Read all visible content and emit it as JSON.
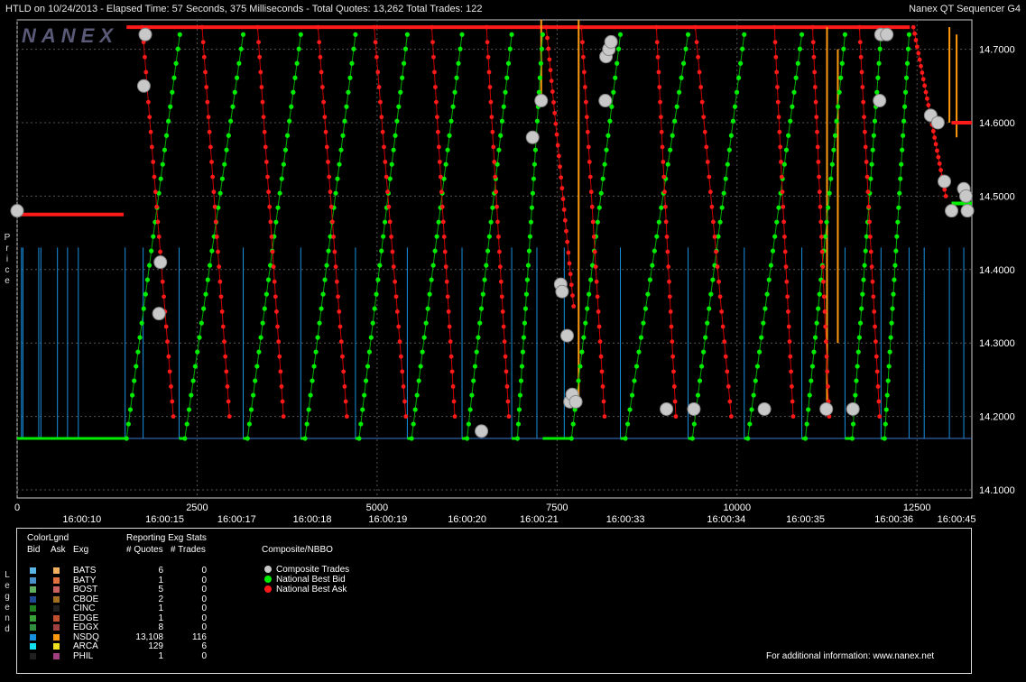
{
  "header": {
    "left": "HTLD on 10/24/2013  -  Elapsed Time: 57 Seconds, 375 Milliseconds  -  Total Quotes: 13,262  Total Trades: 122",
    "right": "Nanex QT Sequencer G4"
  },
  "watermark": "NANEX",
  "side_label_price": "Price",
  "side_label_legend": "Legend",
  "chart_data": {
    "type": "line",
    "y_ticks": [
      "14.7000",
      "14.6000",
      "14.5000",
      "14.4000",
      "14.3000",
      "14.2000",
      "14.1000"
    ],
    "y_tick_values": [
      14.7,
      14.6,
      14.5,
      14.4,
      14.3,
      14.2,
      14.1
    ],
    "ylim": [
      14.089,
      14.74
    ],
    "x_seq_ticks": [
      "0",
      "2500",
      "5000",
      "7500",
      "10000",
      "12500"
    ],
    "x_seq_values": [
      0,
      2500,
      5000,
      7500,
      10000,
      12500
    ],
    "xlim": [
      0,
      13262
    ],
    "x_time_ticks": [
      "16:00:10",
      "16:00:15",
      "16:00:17",
      "16:00:18",
      "16:00:19",
      "16:00:20",
      "16:00:21",
      "16:00:33",
      "16:00:34",
      "16:00:35",
      "16:00:36",
      "16:00:45"
    ],
    "x_time_positions": [
      900,
      2050,
      3050,
      4100,
      5150,
      6250,
      7250,
      8450,
      9850,
      10950,
      12180,
      13050
    ],
    "bid_floor": 14.17,
    "ask_ceiling": 14.73,
    "series": [
      {
        "name": "Composite Trades",
        "color": "#c8c8c8"
      },
      {
        "name": "National Best Bid",
        "color": "#00ee00"
      },
      {
        "name": "National Best Ask",
        "color": "#ff1a1a"
      }
    ],
    "bid_ramps": [
      [
        1520,
        2260,
        14.72
      ],
      [
        2330,
        3140,
        14.72
      ],
      [
        3200,
        3940,
        14.72
      ],
      [
        4000,
        4700,
        14.72
      ],
      [
        4750,
        5420,
        14.72
      ],
      [
        5480,
        6180,
        14.72
      ],
      [
        6250,
        6870,
        14.72
      ],
      [
        6950,
        7300,
        14.72
      ],
      [
        7700,
        8380,
        14.72
      ],
      [
        8450,
        9320,
        14.72
      ],
      [
        9380,
        10100,
        14.72
      ],
      [
        10150,
        10900,
        14.72
      ],
      [
        10950,
        11500,
        14.72
      ],
      [
        11600,
        12000,
        14.72
      ],
      [
        12050,
        12390,
        14.72
      ]
    ],
    "ask_drops": [
      [
        1740,
        14.73,
        2170,
        14.2
      ],
      [
        2570,
        14.73,
        2950,
        14.2
      ],
      [
        3340,
        14.73,
        3700,
        14.2
      ],
      [
        4180,
        14.73,
        4580,
        14.2
      ],
      [
        4960,
        14.73,
        5400,
        14.2
      ],
      [
        5760,
        14.73,
        6080,
        14.2
      ],
      [
        6520,
        14.73,
        6830,
        14.2
      ],
      [
        7350,
        14.73,
        7730,
        14.35
      ],
      [
        7840,
        14.73,
        8160,
        14.2
      ],
      [
        8880,
        14.73,
        9150,
        14.2
      ],
      [
        9420,
        14.73,
        9920,
        14.2
      ],
      [
        10520,
        14.73,
        10780,
        14.2
      ],
      [
        11050,
        14.73,
        11280,
        14.2
      ],
      [
        11700,
        14.73,
        11980,
        14.2
      ],
      [
        12450,
        14.73,
        12900,
        14.5
      ]
    ],
    "trades": [
      [
        0,
        14.48
      ],
      [
        1780,
        14.72
      ],
      [
        1760,
        14.65
      ],
      [
        1990,
        14.41
      ],
      [
        1970,
        14.34
      ],
      [
        6450,
        14.18
      ],
      [
        7160,
        14.58
      ],
      [
        7280,
        14.63
      ],
      [
        7550,
        14.38
      ],
      [
        7570,
        14.37
      ],
      [
        7640,
        14.31
      ],
      [
        7680,
        14.22
      ],
      [
        7710,
        14.23
      ],
      [
        7760,
        14.22
      ],
      [
        8180,
        14.69
      ],
      [
        8220,
        14.7
      ],
      [
        8250,
        14.71
      ],
      [
        8170,
        14.63
      ],
      [
        9020,
        14.21
      ],
      [
        9400,
        14.21
      ],
      [
        10380,
        14.21
      ],
      [
        11240,
        14.21
      ],
      [
        11610,
        14.21
      ],
      [
        11980,
        14.63
      ],
      [
        12000,
        14.72
      ],
      [
        12080,
        14.72
      ],
      [
        12690,
        14.61
      ],
      [
        12790,
        14.6
      ],
      [
        12880,
        14.52
      ],
      [
        12980,
        14.48
      ],
      [
        13150,
        14.51
      ],
      [
        13180,
        14.5
      ],
      [
        13200,
        14.48
      ]
    ]
  },
  "legend": {
    "title_color": "ColorLgnd",
    "col_bid": "Bid",
    "col_ask": "Ask",
    "col_exg": "Exg",
    "title_stats": "Reporting Exg Stats",
    "col_quotes": "# Quotes",
    "col_trades": "# Trades",
    "title_composite": "Composite/NBBO",
    "rows": [
      {
        "exg": "BATS",
        "quotes": "6",
        "trades": "0",
        "bid": "#5ab4e6",
        "ask": "#f0b060"
      },
      {
        "exg": "BATY",
        "quotes": "1",
        "trades": "0",
        "bid": "#4a90c8",
        "ask": "#e07040"
      },
      {
        "exg": "BOST",
        "quotes": "5",
        "trades": "0",
        "bid": "#60b060",
        "ask": "#c86060"
      },
      {
        "exg": "CBOE",
        "quotes": "2",
        "trades": "0",
        "bid": "#204890",
        "ask": "#a07020"
      },
      {
        "exg": "CINC",
        "quotes": "1",
        "trades": "0",
        "bid": "#208020",
        "ask": "#202020"
      },
      {
        "exg": "EDGE",
        "quotes": "1",
        "trades": "0",
        "bid": "#38a038",
        "ask": "#c05030"
      },
      {
        "exg": "EDGX",
        "quotes": "8",
        "trades": "0",
        "bid": "#309040",
        "ask": "#a04040"
      },
      {
        "exg": "NSDQ",
        "quotes": "13,108",
        "trades": "116",
        "bid": "#1890e0",
        "ask": "#ff9a10"
      },
      {
        "exg": "ARCA",
        "quotes": "129",
        "trades": "6",
        "bid": "#10e0f0",
        "ask": "#f0e020"
      },
      {
        "exg": "PHIL",
        "quotes": "1",
        "trades": "0",
        "bid": "#202020",
        "ask": "#a04080"
      }
    ],
    "composite": [
      {
        "label": "Composite Trades",
        "color": "#c8c8c8"
      },
      {
        "label": "National Best Bid",
        "color": "#00ee00"
      },
      {
        "label": "National Best Ask",
        "color": "#ff1a1a"
      }
    ],
    "info": "For additional information: www.nanex.net"
  }
}
